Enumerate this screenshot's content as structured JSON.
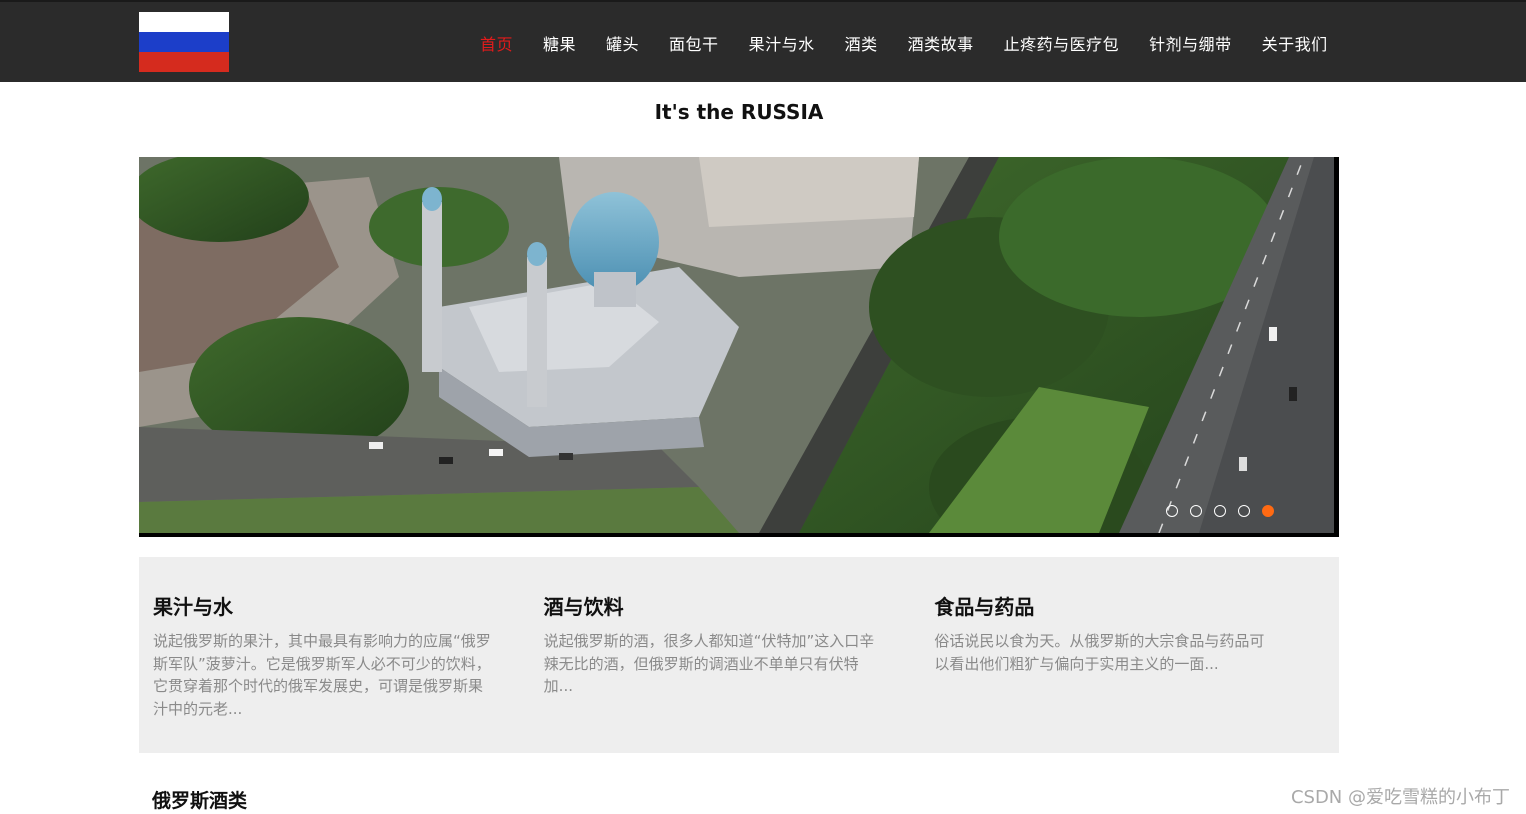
{
  "brand": {
    "flag_colors": [
      "#ffffff",
      "#1c3ec9",
      "#d52b1e"
    ]
  },
  "nav": {
    "items": [
      {
        "label": "首页",
        "active": true
      },
      {
        "label": "糖果"
      },
      {
        "label": "罐头"
      },
      {
        "label": "面包干"
      },
      {
        "label": "果汁与水"
      },
      {
        "label": "酒类"
      },
      {
        "label": "酒类故事"
      },
      {
        "label": "止疼药与医疗包"
      },
      {
        "label": "针剂与绷带"
      },
      {
        "label": "关于我们"
      }
    ],
    "active_color": "#e21b1b"
  },
  "headline": "It's the RUSSIA",
  "carousel": {
    "slide_count": 5,
    "active_index": 4,
    "active_color": "#ff6a13"
  },
  "features": [
    {
      "title": "果汁与水",
      "text": "说起俄罗斯的果汁，其中最具有影响力的应属“俄罗斯军队”菠萝汁。它是俄罗斯军人必不可少的饮料，它贯穿着那个时代的俄军发展史，可谓是俄罗斯果汁中的元老..."
    },
    {
      "title": "酒与饮料",
      "text": "说起俄罗斯的酒，很多人都知道“伏特加”这入口辛辣无比的酒，但俄罗斯的调酒业不单单只有伏特加..."
    },
    {
      "title": "食品与药品",
      "text": "俗话说民以食为天。从俄罗斯的大宗食品与药品可以看出他们粗犷与偏向于实用主义的一面..."
    }
  ],
  "section_title": "俄罗斯酒类",
  "watermark": "CSDN @爱吃雪糕的小布丁"
}
